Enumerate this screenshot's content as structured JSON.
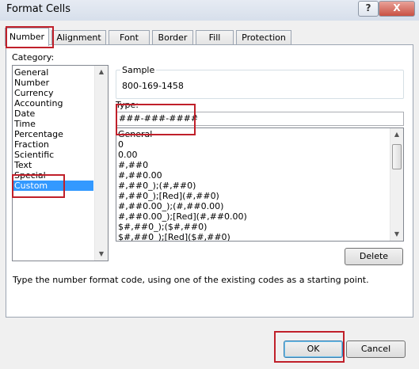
{
  "window": {
    "title": "Format Cells",
    "help_glyph": "?",
    "close_glyph": "X"
  },
  "tabs": [
    "Number",
    "Alignment",
    "Font",
    "Border",
    "Fill",
    "Protection"
  ],
  "category": {
    "label": "Category:",
    "items": [
      "General",
      "Number",
      "Currency",
      "Accounting",
      "Date",
      "Time",
      "Percentage",
      "Fraction",
      "Scientific",
      "Text",
      "Special",
      "Custom"
    ],
    "selected": "Custom"
  },
  "sample": {
    "label": "Sample",
    "value": "800-169-1458"
  },
  "type": {
    "label": "Type:",
    "value": "###-###-####"
  },
  "format_codes": [
    "General",
    "0",
    "0.00",
    "#,##0",
    "#,##0.00",
    "#,##0_);(#,##0)",
    "#,##0_);[Red](#,##0)",
    "#,##0.00_);(#,##0.00)",
    "#,##0.00_);[Red](#,##0.00)",
    "$#,##0_);($#,##0)",
    "$#,##0_);[Red]($#,##0)"
  ],
  "buttons": {
    "delete": "Delete",
    "ok": "OK",
    "cancel": "Cancel"
  },
  "hint": "Type the number format code, using one of the existing codes as a starting point.",
  "colors": {
    "selection": "#3399ff",
    "highlight_box": "#c0202a"
  }
}
